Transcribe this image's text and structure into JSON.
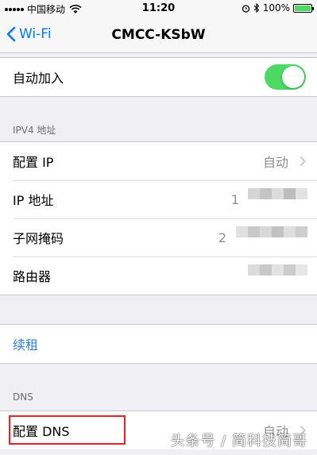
{
  "status_bar": {
    "carrier": "中国移动",
    "time": "11:20",
    "battery_percent": "100%",
    "battery_level": 1.0
  },
  "nav": {
    "back_label": "Wi-Fi",
    "title": "CMCC-KSbW"
  },
  "auto_join": {
    "label": "自动加入",
    "enabled": true
  },
  "ipv4": {
    "header": "IPV4 地址",
    "rows": [
      {
        "label": "配置 IP",
        "value": "自动"
      },
      {
        "label": "IP 地址",
        "value": "1"
      },
      {
        "label": "子网掩码",
        "value": "2"
      },
      {
        "label": "路由器",
        "value": ""
      }
    ]
  },
  "renew": {
    "label": "续租"
  },
  "dns": {
    "header": "DNS",
    "config_label": "配置 DNS",
    "config_value": "自动"
  },
  "watermark": "头条号 / 简科技简哥",
  "colors": {
    "accent": "#007aff",
    "toggle_on": "#4cd964",
    "highlight": "#e6202a"
  }
}
